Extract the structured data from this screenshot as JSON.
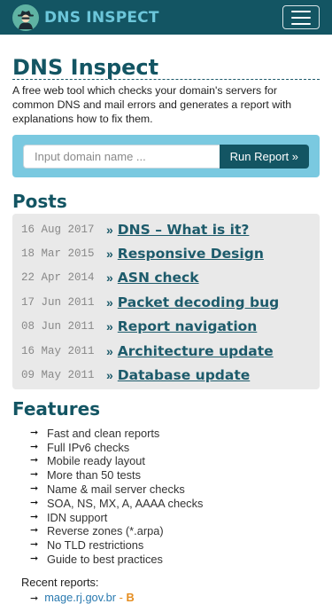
{
  "brand": {
    "name": "DNS INSPECT",
    "logo_icon": "spy-icon"
  },
  "header": {
    "title": "DNS Inspect",
    "intro": "A free web tool which checks your domain's servers for common DNS and mail errors and generates a report with explanations how to fix them."
  },
  "search": {
    "placeholder": "Input domain name ...",
    "button": "Run Report »"
  },
  "posts": {
    "heading": "Posts",
    "arrow": "»",
    "items": [
      {
        "date": "16 Aug 2017",
        "title": "DNS – What is it?"
      },
      {
        "date": "18 Mar 2015",
        "title": "Responsive Design"
      },
      {
        "date": "22 Apr 2014",
        "title": "ASN check"
      },
      {
        "date": "17 Jun 2011",
        "title": "Packet decoding bug"
      },
      {
        "date": "08 Jun 2011",
        "title": "Report navigation"
      },
      {
        "date": "16 May 2011",
        "title": "Architecture update"
      },
      {
        "date": "09 May 2011",
        "title": "Database update"
      }
    ]
  },
  "features": {
    "heading": "Features",
    "bullet": "➞",
    "items": [
      "Fast and clean reports",
      "Full IPv6 checks",
      "Mobile ready layout",
      "More than 50 tests",
      "Name & mail server checks",
      "SOA, NS, MX, A, AAAA checks",
      "IDN support",
      "Reverse zones (*.arpa)",
      "No TLD restrictions",
      "Guide to best practices"
    ]
  },
  "recent": {
    "label": "Recent reports:",
    "items": [
      {
        "domain": "mage.rj.gov.br",
        "sep": " - ",
        "grade": "B"
      }
    ]
  },
  "colors": {
    "navbar": "#135563",
    "accent": "#1d5b6b",
    "search_bg": "#7ac9e0",
    "posts_bg": "#e9e9e9"
  }
}
